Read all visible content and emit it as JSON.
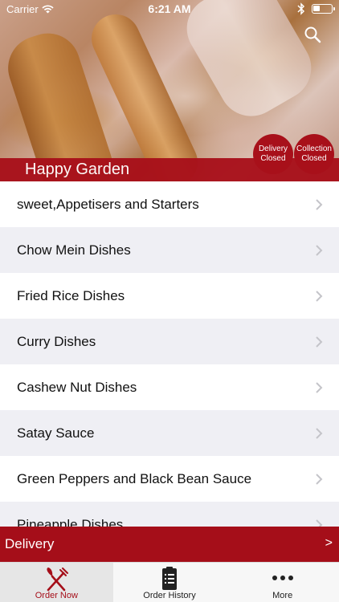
{
  "status_bar": {
    "carrier": "Carrier",
    "time": "6:21 AM"
  },
  "header": {
    "restaurant_name": "Happy Garden",
    "delivery_badge": [
      "Delivery",
      "Closed"
    ],
    "collection_badge": [
      "Collection",
      "Closed"
    ]
  },
  "menu": {
    "items": [
      {
        "label": "sweet,Appetisers and Starters"
      },
      {
        "label": "Chow Mein Dishes"
      },
      {
        "label": "Fried Rice Dishes"
      },
      {
        "label": "Curry Dishes"
      },
      {
        "label": "Cashew Nut Dishes"
      },
      {
        "label": "Satay Sauce"
      },
      {
        "label": "Green Peppers and Black Bean Sauce"
      },
      {
        "label": "Pineapple Dishes"
      }
    ]
  },
  "delivery_bar": {
    "label": "Delivery",
    "arrow": ">"
  },
  "tabs": [
    {
      "label": "Order Now",
      "icon": "fork-knife-icon"
    },
    {
      "label": "Order History",
      "icon": "clipboard-icon"
    },
    {
      "label": "More",
      "icon": "more-dots-icon"
    }
  ],
  "colors": {
    "brand_red": "#a50e19",
    "list_alt_row": "#efeff4"
  }
}
